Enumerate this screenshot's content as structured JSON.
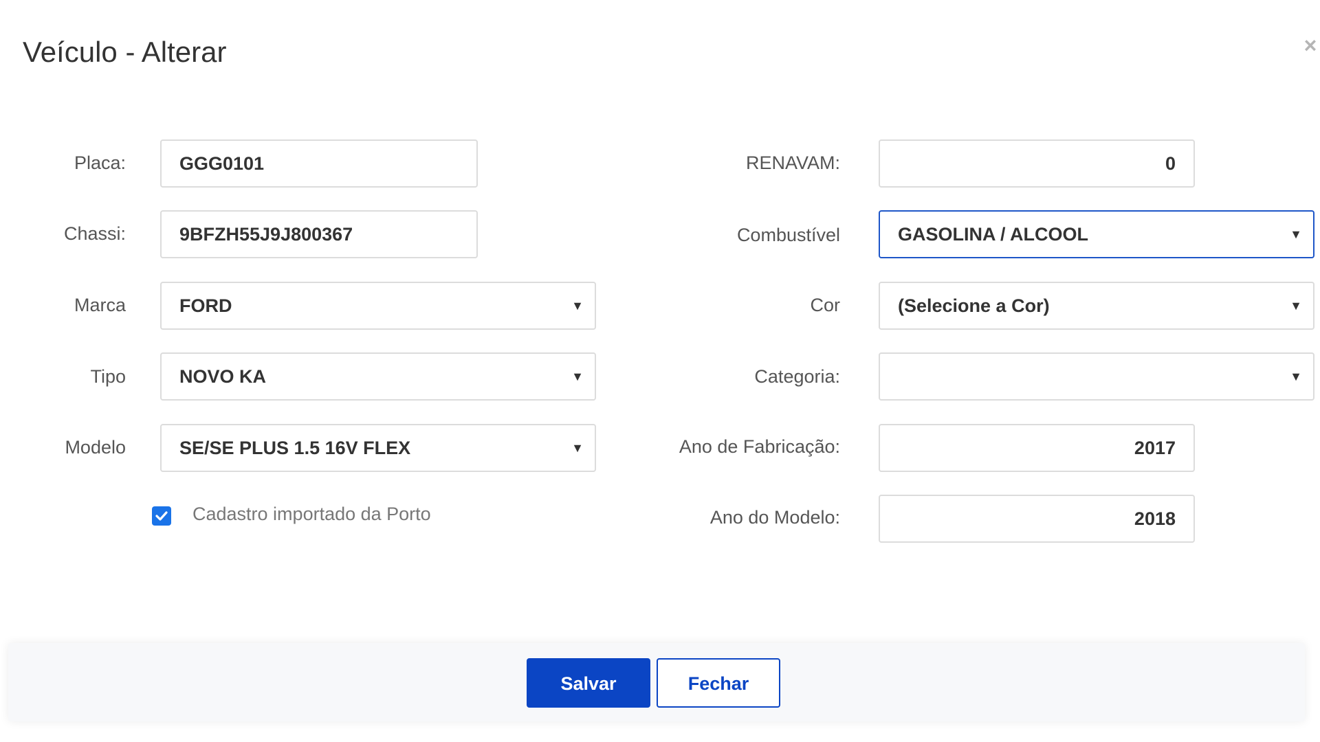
{
  "dialog": {
    "title": "Veículo - Alterar",
    "close_icon": "×"
  },
  "left_fields": {
    "placa": {
      "label": "Placa:",
      "value": "GGG0101"
    },
    "chassi": {
      "label": "Chassi:",
      "value": "9BFZH55J9J800367"
    },
    "marca": {
      "label": "Marca",
      "value": "FORD"
    },
    "tipo": {
      "label": "Tipo",
      "value": "NOVO KA"
    },
    "modelo": {
      "label": "Modelo",
      "value": "SE/SE PLUS 1.5 16V FLEX"
    }
  },
  "right_fields": {
    "renavam": {
      "label": "RENAVAM:",
      "value": "0"
    },
    "combustivel": {
      "label": "Combustível",
      "value": "GASOLINA / ALCOOL"
    },
    "cor": {
      "label": "Cor",
      "value": "(Selecione a Cor)"
    },
    "categoria": {
      "label": "Categoria:",
      "value": ""
    },
    "ano_fabricacao": {
      "label": "Ano de Fabricação:",
      "value": "2017"
    },
    "ano_modelo": {
      "label": "Ano do Modelo:",
      "value": "2018"
    }
  },
  "checkbox": {
    "label": "Cadastro importado da Porto",
    "checked": true
  },
  "footer": {
    "save_label": "Salvar",
    "close_label": "Fechar"
  },
  "icons": {
    "dropdown": "▼",
    "close": "close-icon",
    "check": "check-icon"
  },
  "colors": {
    "primary": "#0b45c4",
    "focus_border": "#1e56c8",
    "checkbox": "#1a73e8"
  }
}
